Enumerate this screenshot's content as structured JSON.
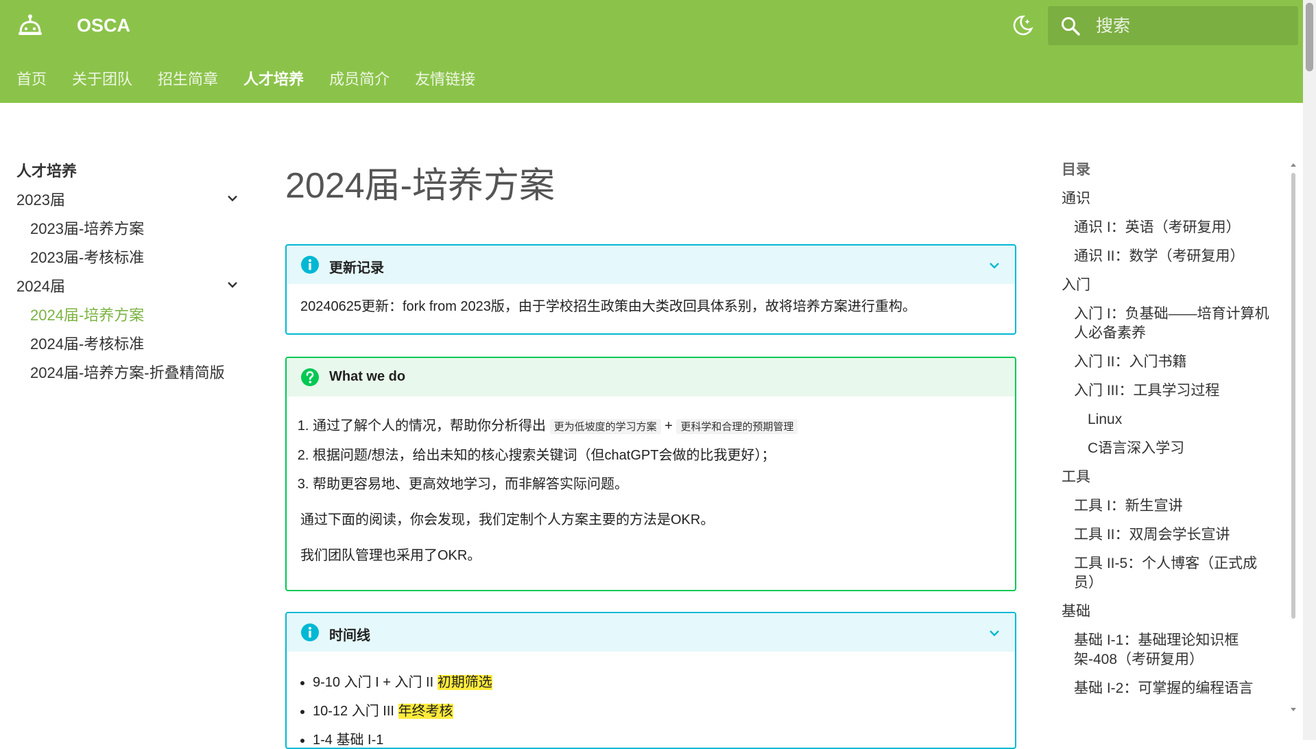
{
  "header": {
    "site_title": "OSCA",
    "search_placeholder": "搜索",
    "tabs": [
      {
        "label": "首页",
        "active": false
      },
      {
        "label": "关于团队",
        "active": false
      },
      {
        "label": "招生简章",
        "active": false
      },
      {
        "label": "人才培养",
        "active": true
      },
      {
        "label": "成员简介",
        "active": false
      },
      {
        "label": "友情链接",
        "active": false
      }
    ],
    "accent_color": "#8bc34a"
  },
  "left_nav": {
    "title": "人才培养",
    "groups": [
      {
        "label": "2023届",
        "items": [
          "2023届-培养方案",
          "2023届-考核标准"
        ]
      },
      {
        "label": "2024届",
        "items": [
          "2024届-培养方案",
          "2024届-考核标准",
          "2024届-培养方案-折叠精简版"
        ]
      }
    ],
    "active_item": "2024届-培养方案"
  },
  "main": {
    "title": "2024届-培养方案",
    "update_box": {
      "title": "更新记录",
      "text": "20240625更新：fork from 2023版，由于学校招生政策由大类改回具体系别，故将培养方案进行重构。"
    },
    "whatwedo_box": {
      "title": "What we do",
      "item1_text": "通过了解个人的情况，帮助你分析得出",
      "item1_code1": "更为低坡度的学习方案",
      "item1_plus": "+",
      "item1_code2": "更科学和合理的预期管理",
      "item2": "根据问题/想法，给出未知的核心搜索关键词（但chatGPT会做的比我更好）；",
      "item3": "帮助更容易地、更高效地学习，而非解答实际问题。",
      "para1": "通过下面的阅读，你会发现，我们定制个人方案主要的方法是OKR。",
      "para2": "我们团队管理也采用了OKR。"
    },
    "timeline_box": {
      "title": "时间线",
      "items": [
        {
          "text": "9-10 入门 I + 入门 II ",
          "mark": "初期筛选"
        },
        {
          "text": "10-12 入门 III ",
          "mark": "年终考核"
        },
        {
          "text": "1-4 基础 I-1",
          "mark": ""
        }
      ]
    }
  },
  "toc": {
    "title": "目录",
    "items": [
      {
        "label": "通识",
        "level": 1
      },
      {
        "label": "通识 I：英语（考研复用）",
        "level": 2
      },
      {
        "label": "通识 II：数学（考研复用）",
        "level": 2
      },
      {
        "label": "入门",
        "level": 1
      },
      {
        "label": "入门 I：负基础——培育计算机人必备素养",
        "level": 2
      },
      {
        "label": "入门 II：入门书籍",
        "level": 2
      },
      {
        "label": "入门 III：工具学习过程",
        "level": 2
      },
      {
        "label": "Linux",
        "level": 3
      },
      {
        "label": "C语言深入学习",
        "level": 3
      },
      {
        "label": "工具",
        "level": 1
      },
      {
        "label": "工具 I：新生宣讲",
        "level": 2
      },
      {
        "label": "工具 II：双周会学长宣讲",
        "level": 2
      },
      {
        "label": "工具 II-5：个人博客（正式成员）",
        "level": 2
      },
      {
        "label": "基础",
        "level": 1
      },
      {
        "label": "基础 I-1：基础理论知识框架-408（考研复用）",
        "level": 2
      },
      {
        "label": "基础 I-2：可掌握的编程语言",
        "level": 2
      }
    ]
  }
}
